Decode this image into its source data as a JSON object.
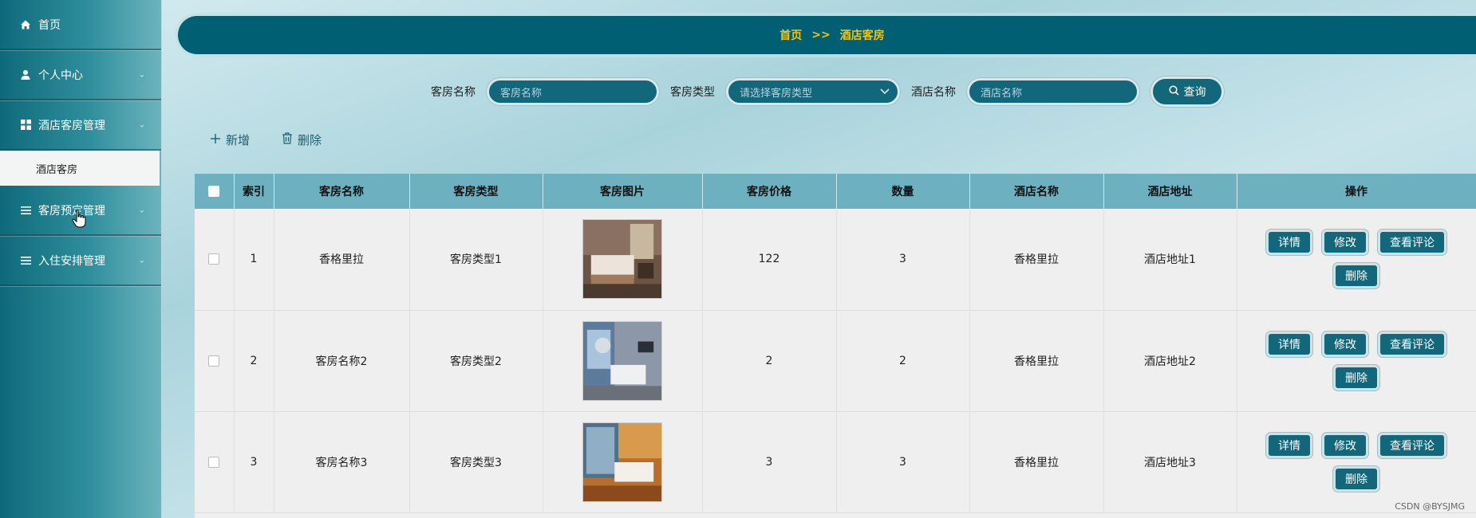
{
  "sidebar": {
    "items": [
      {
        "label": "首页",
        "icon": "home-icon",
        "has_children": false
      },
      {
        "label": "个人中心",
        "icon": "user-icon",
        "has_children": true
      },
      {
        "label": "酒店客房管理",
        "icon": "grid-icon",
        "has_children": true
      },
      {
        "label": "客房预定管理",
        "icon": "list-icon",
        "has_children": true
      },
      {
        "label": "入住安排管理",
        "icon": "list-icon",
        "has_children": true
      }
    ],
    "submenu": {
      "label": "酒店客房"
    }
  },
  "breadcrumb": {
    "home": "首页",
    "separator": ">>",
    "current": "酒店客房"
  },
  "search": {
    "room_name_label": "客房名称",
    "room_name_placeholder": "客房名称",
    "room_type_label": "客房类型",
    "room_type_placeholder": "请选择客房类型",
    "hotel_name_label": "酒店名称",
    "hotel_name_placeholder": "酒店名称",
    "query_label": "查询"
  },
  "actions": {
    "add_label": "新增",
    "delete_label": "删除"
  },
  "table": {
    "headers": [
      "索引",
      "客房名称",
      "客房类型",
      "客房图片",
      "客房价格",
      "数量",
      "酒店名称",
      "酒店地址",
      "操作"
    ],
    "rows": [
      {
        "index": "1",
        "name": "香格里拉",
        "type": "客房类型1",
        "price": "122",
        "count": "3",
        "hotel": "香格里拉",
        "address": "酒店地址1"
      },
      {
        "index": "2",
        "name": "客房名称2",
        "type": "客房类型2",
        "price": "2",
        "count": "2",
        "hotel": "香格里拉",
        "address": "酒店地址2"
      },
      {
        "index": "3",
        "name": "客房名称3",
        "type": "客房类型3",
        "price": "3",
        "count": "3",
        "hotel": "香格里拉",
        "address": "酒店地址3"
      }
    ],
    "row_buttons": {
      "detail": "详情",
      "edit": "修改",
      "reviews": "查看评论",
      "delete": "删除"
    }
  },
  "watermark": "CSDN @BYSJMG",
  "colors": {
    "accent": "#12677a",
    "breadcrumb_text": "#f0c419",
    "header_bg": "#6db1c0"
  }
}
